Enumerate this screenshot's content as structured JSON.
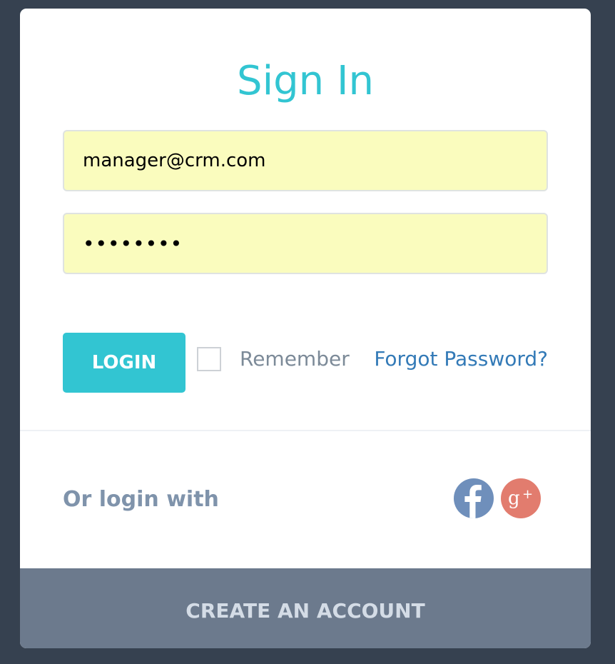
{
  "form": {
    "title": "Sign In",
    "email_value": "manager@crm.com",
    "password_value": "••••••••",
    "login_label": "LOGIN",
    "remember_label": "Remember",
    "remember_checked": false,
    "forgot_label": "Forgot Password?"
  },
  "social": {
    "label": "Or login with",
    "providers": [
      {
        "name": "facebook",
        "icon": "facebook-icon",
        "color": "#6f8fbb"
      },
      {
        "name": "google-plus",
        "icon": "google-plus-icon",
        "color": "#e27c6e"
      }
    ]
  },
  "footer": {
    "create_account_label": "CREATE AN ACCOUNT"
  },
  "colors": {
    "accent": "#32c5d2",
    "background": "#364150",
    "link": "#337ab7",
    "input_fill": "#fafcbe",
    "footer": "#6c7a8d"
  }
}
